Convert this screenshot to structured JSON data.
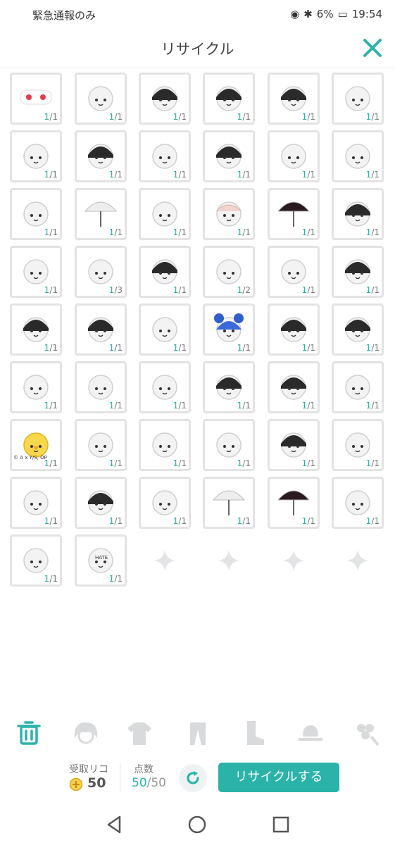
{
  "status": {
    "carrier": "緊急通報のみ",
    "battery": "6%",
    "time": "19:54"
  },
  "header": {
    "title": "リサイクル",
    "close_icon": "close-icon"
  },
  "items": [
    {
      "icon": "strawberry-collar",
      "count": "1",
      "total": "1"
    },
    {
      "icon": "white-tights",
      "count": "1",
      "total": "1"
    },
    {
      "icon": "black-boots",
      "count": "1",
      "total": "1"
    },
    {
      "icon": "black-boots-2",
      "count": "1",
      "total": "1"
    },
    {
      "icon": "black-dress",
      "count": "1",
      "total": "1"
    },
    {
      "icon": "face",
      "count": "1",
      "total": "1"
    },
    {
      "icon": "pink-outfit",
      "count": "1",
      "total": "1"
    },
    {
      "icon": "black-skirt",
      "count": "1",
      "total": "1"
    },
    {
      "icon": "white-shoes",
      "count": "1",
      "total": "1"
    },
    {
      "icon": "black-shoes",
      "count": "1",
      "total": "1"
    },
    {
      "icon": "rose-hair-accessory",
      "count": "1",
      "total": "1"
    },
    {
      "icon": "doll-body",
      "count": "1",
      "total": "1"
    },
    {
      "icon": "white-bonnet",
      "count": "1",
      "total": "1"
    },
    {
      "icon": "white-parasol",
      "count": "1",
      "total": "1"
    },
    {
      "icon": "white-ribbon",
      "count": "1",
      "total": "1"
    },
    {
      "icon": "pink-headdress",
      "count": "1",
      "total": "1"
    },
    {
      "icon": "red-black-parasol",
      "count": "1",
      "total": "1"
    },
    {
      "icon": "black-bow",
      "count": "1",
      "total": "1"
    },
    {
      "icon": "cat-costume",
      "count": "1",
      "total": "1"
    },
    {
      "icon": "white-wings",
      "count": "1",
      "total": "3"
    },
    {
      "icon": "black-hat",
      "count": "1",
      "total": "1"
    },
    {
      "icon": "white-collar",
      "count": "1",
      "total": "2"
    },
    {
      "icon": "blush-face",
      "count": "1",
      "total": "1"
    },
    {
      "icon": "black-hair",
      "count": "1",
      "total": "1"
    },
    {
      "icon": "black-beanie",
      "count": "1",
      "total": "1"
    },
    {
      "icon": "black-cat-hat",
      "count": "1",
      "total": "1"
    },
    {
      "icon": "doll-black-gloves",
      "count": "1",
      "total": "1"
    },
    {
      "icon": "blue-bear-hat",
      "count": "1",
      "total": "1"
    },
    {
      "icon": "black-cape",
      "count": "1",
      "total": "1"
    },
    {
      "icon": "black-buns-hair",
      "count": "1",
      "total": "1"
    },
    {
      "icon": "pink-blush-face",
      "count": "1",
      "total": "1"
    },
    {
      "icon": "white-buns-hair",
      "count": "1",
      "total": "1"
    },
    {
      "icon": "bunny-hair",
      "count": "1",
      "total": "1"
    },
    {
      "icon": "black-twin-hair",
      "count": "1",
      "total": "1"
    },
    {
      "icon": "black-bob-hair",
      "count": "1",
      "total": "1"
    },
    {
      "icon": "striped-hat",
      "count": "1",
      "total": "1"
    },
    {
      "icon": "yellow-chick",
      "count": "1",
      "total": "1",
      "credit": "© A x Y/S, OP"
    },
    {
      "icon": "plain-face",
      "count": "1",
      "total": "1"
    },
    {
      "icon": "swirl-glasses",
      "count": "1",
      "total": "1"
    },
    {
      "icon": "white-hood",
      "count": "1",
      "total": "1"
    },
    {
      "icon": "check-glasses",
      "count": "1",
      "total": "1"
    },
    {
      "icon": "octopus-costume",
      "count": "1",
      "total": "1"
    },
    {
      "icon": "cat-ear-hat",
      "count": "1",
      "total": "1"
    },
    {
      "icon": "black-bow-headband",
      "count": "1",
      "total": "1"
    },
    {
      "icon": "cat-ear-headband",
      "count": "1",
      "total": "1"
    },
    {
      "icon": "white-umbrella",
      "count": "1",
      "total": "1"
    },
    {
      "icon": "black-lace-parasol",
      "count": "1",
      "total": "1"
    },
    {
      "icon": "white-hair",
      "count": "1",
      "total": "1"
    },
    {
      "icon": "purple-nightcap",
      "count": "1",
      "total": "1"
    },
    {
      "icon": "hate-cat-hat",
      "count": "1",
      "total": "1",
      "text": "HATE"
    }
  ],
  "empty_slots": 4,
  "tabs": [
    {
      "icon": "trash-icon",
      "active": true
    },
    {
      "icon": "hair-icon",
      "active": false
    },
    {
      "icon": "shirt-icon",
      "active": false
    },
    {
      "icon": "bottoms-icon",
      "active": false
    },
    {
      "icon": "boot-icon",
      "active": false
    },
    {
      "icon": "hat-icon",
      "active": false
    },
    {
      "icon": "accessory-icon",
      "active": false
    }
  ],
  "bottom": {
    "received_label": "受取リコ",
    "received_value": "50",
    "points_label": "点数",
    "points_current": "50",
    "points_total": "/50",
    "recycle_button": "リサイクルする"
  },
  "colors": {
    "accent": "#2bb3aa",
    "border": "#e3e3e3",
    "count_accent": "#22b3a8"
  }
}
